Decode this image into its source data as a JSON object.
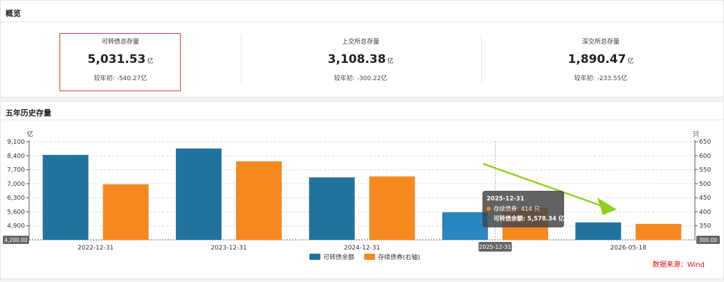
{
  "overview": {
    "title": "概览",
    "stats": [
      {
        "label": "可转债总存量",
        "value": "5,031.53",
        "unit": "亿",
        "change": "较年初: -540.27亿"
      },
      {
        "label": "上交所总存量",
        "value": "3,108.38",
        "unit": "亿",
        "change": "较年初: -300.22亿"
      },
      {
        "label": "深交所总存量",
        "value": "1,890.47",
        "unit": "亿",
        "change": "较年初: -233.55亿"
      }
    ]
  },
  "history": {
    "title": "五年历史存量",
    "source": "数据来源：Wind"
  },
  "colors": {
    "balance": "#21739e",
    "count": "#f5891f",
    "highlight": "#e03333",
    "arrow": "#8fd11a"
  },
  "chart_data": {
    "type": "bar",
    "categories": [
      "2022-12-31",
      "2023-12-31",
      "2024-12-31",
      "2025-12-31",
      "2026-05-18"
    ],
    "series": [
      {
        "name": "可转债余额",
        "axis": "left",
        "values": [
          8440,
          8760,
          7320,
          5578.34,
          5070
        ]
      },
      {
        "name": "存续债券(右轴)",
        "axis": "right",
        "values": [
          498,
          580,
          526,
          414,
          357
        ]
      }
    ],
    "left_axis": {
      "unit": "亿",
      "ticks": [
        "9,100",
        "8,400",
        "7,700",
        "7,000",
        "6,300",
        "5,600",
        "4,900"
      ],
      "ylim": [
        4200,
        9100
      ],
      "min_label": "4,200.00"
    },
    "right_axis": {
      "unit": "只",
      "ticks": [
        "650",
        "600",
        "550",
        "500",
        "450",
        "400",
        "350"
      ],
      "ylim": [
        300,
        650
      ],
      "min_label": "300.00"
    },
    "grid": true,
    "legend_position": "bottom",
    "tooltip": {
      "category": "2025-12-31",
      "title": "2025-12-31",
      "rows": [
        {
          "name": "存续债券",
          "value": "414",
          "unit": "只"
        },
        {
          "name": "可转债余额",
          "value": "5,578.34",
          "unit": "亿"
        }
      ]
    }
  }
}
